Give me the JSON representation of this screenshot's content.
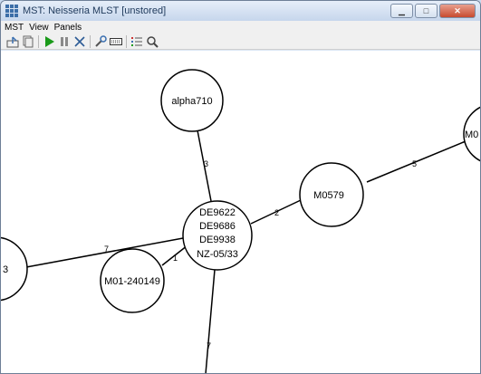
{
  "window": {
    "title": "MST: Neisseria MLST [unstored]",
    "buttons": {
      "minimize": "▁",
      "maximize": "□",
      "close": "✕"
    }
  },
  "menu": [
    "MST",
    "View",
    "Panels"
  ],
  "toolbar": {
    "icons": [
      "export-icon",
      "copy-icon",
      "play-icon",
      "pause-icon",
      "expand-icon",
      "tools-icon",
      "keyboard-icon",
      "list-icon",
      "zoom-icon"
    ]
  },
  "graph": {
    "nodes": {
      "alpha710": {
        "label": "alpha710"
      },
      "center": {
        "lines": [
          "DE9622",
          "DE9686",
          "DE9938",
          "NZ-05/33"
        ]
      },
      "m0579": {
        "label": "M0579"
      },
      "m01_240149": {
        "label": "M01-240149"
      },
      "right_partial": {
        "label": "M0"
      },
      "left_partial": {
        "label": "3"
      }
    },
    "edges": {
      "alpha_center": "3",
      "center_m0579": "2",
      "m0579_right": "5",
      "center_left": "7",
      "center_m01": "1",
      "center_bottom": "7"
    }
  },
  "colors": {
    "canvas": "#ffffff",
    "node_stroke": "#000000",
    "play": "#1a9a1a"
  }
}
